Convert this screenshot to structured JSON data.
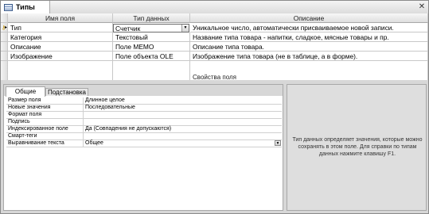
{
  "window": {
    "tab_title": "Типы",
    "close_glyph": "✕"
  },
  "grid": {
    "columns": [
      "Имя поля",
      "Тип данных",
      "Описание"
    ],
    "rows": [
      {
        "name": "Тип",
        "type": "Счетчик",
        "description": "Уникальное число, автоматически присваиваемое новой записи."
      },
      {
        "name": "Категория",
        "type": "Текстовый",
        "description": "Название типа товара - напитки, сладкое, мясные товары и пр."
      },
      {
        "name": "Описание",
        "type": "Поле MEMO",
        "description": "Описание типа товара."
      },
      {
        "name": "Изображение",
        "type": "Поле объекта OLE",
        "description": "Изображение типа товара (не в таблице, а в форме)."
      }
    ]
  },
  "properties_label": "Свойства поля",
  "tabs": [
    "Общие",
    "Подстановка"
  ],
  "properties": [
    {
      "label": "Размер поля",
      "value": "Длинное целое"
    },
    {
      "label": "Новые значения",
      "value": "Последовательные"
    },
    {
      "label": "Формат поля",
      "value": ""
    },
    {
      "label": "Подпись",
      "value": ""
    },
    {
      "label": "Индексированное поле",
      "value": "Да (Совпадения не допускаются)"
    },
    {
      "label": "Смарт-теги",
      "value": ""
    },
    {
      "label": "Выравнивание текста",
      "value": "Общее"
    }
  ],
  "help_text": "Тип данных определяет значения, которые можно сохранять в этом поле.  Для справки по типам данных нажмите клавишу F1.",
  "icons": {
    "key": "key-icon",
    "current_row": "arrow-icon",
    "dropdown": "chevron-down-icon",
    "table": "table-icon"
  }
}
